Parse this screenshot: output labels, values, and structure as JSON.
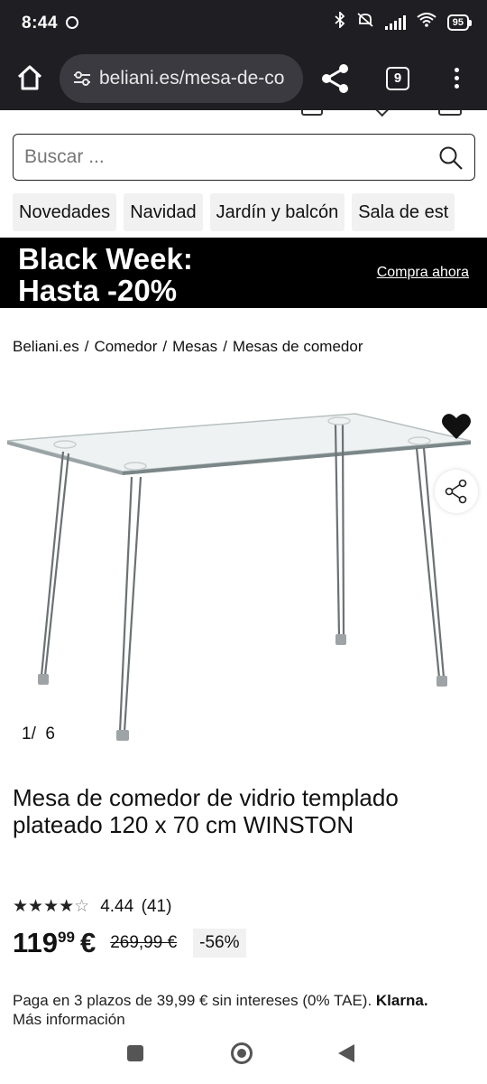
{
  "status_bar": {
    "time": "8:44",
    "battery": "95",
    "icons": [
      "bluetooth-icon",
      "mute-icon",
      "signal-icon",
      "wifi-icon",
      "battery-icon"
    ]
  },
  "browser": {
    "url": "beliani.es/mesa-de-co",
    "tab_count": "9"
  },
  "search": {
    "placeholder": "Buscar ..."
  },
  "categories": [
    "Novedades",
    "Navidad",
    "Jardín y balcón",
    "Sala de est"
  ],
  "banner": {
    "line1": "Black Week:",
    "line2": "Hasta -20%",
    "cta": "Compra ahora"
  },
  "breadcrumb": [
    "Beliani.es",
    "Comedor",
    "Mesas",
    "Mesas de comedor"
  ],
  "gallery": {
    "current": "1",
    "separator": "/",
    "total": "6"
  },
  "product": {
    "title": "Mesa de comedor de vidrio templado plateado 120 x 70 cm WINSTON",
    "rating": "4.44",
    "reviews": "(41)",
    "rating_value": 4.44,
    "price_int": "119",
    "price_cents": "99",
    "currency": "€",
    "old_price": "269,99 €",
    "discount": "-56%"
  },
  "klarna": {
    "text": "Paga en 3 plazos de 39,99 € sin intereses (0% TAE).",
    "brand": "Klarna.",
    "more": "Más información"
  },
  "colors": {
    "status_bg": "#1f1f23",
    "url_pill": "#3a3a40",
    "banner_bg": "#000000",
    "chip_bg": "#f1f1f1",
    "logo_red": "#e03a1e"
  }
}
